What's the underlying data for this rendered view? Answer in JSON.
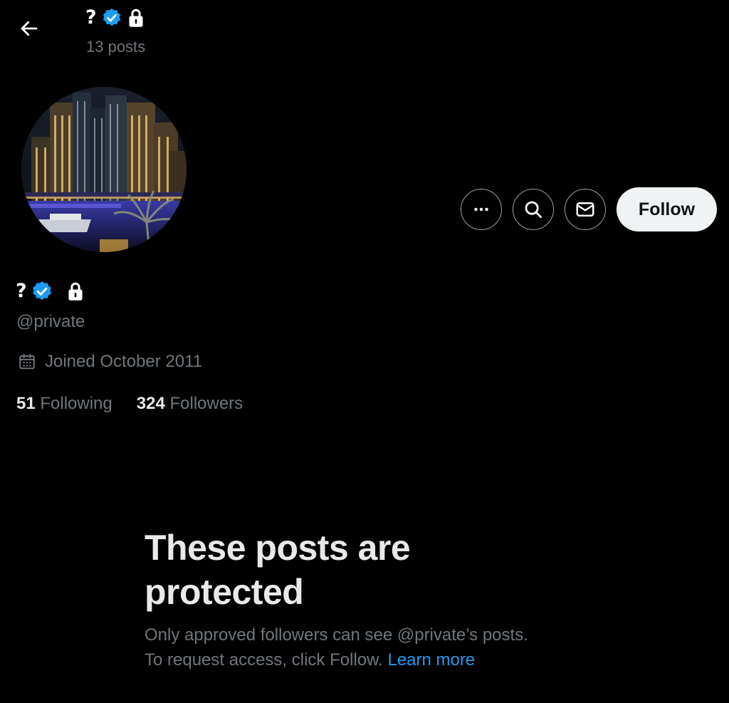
{
  "header": {
    "name": "?",
    "posts_count": "13 posts"
  },
  "actions": {
    "follow_label": "Follow"
  },
  "profile": {
    "name": "?",
    "handle": "@private",
    "joined": "Joined October 2011",
    "following_count": "51",
    "following_label": "Following",
    "followers_count": "324",
    "followers_label": "Followers"
  },
  "protected": {
    "title_line1": "These posts are",
    "title_line2": "protected",
    "line1": "Only approved followers can see @private’s posts.",
    "line2": "To request access, click Follow.",
    "learn_more": "Learn more"
  },
  "colors": {
    "background": "#000000",
    "text_primary": "#e7e9ea",
    "text_secondary": "#71767b",
    "verified_badge": "#1d9bf0",
    "link": "#1d9bf0"
  },
  "icons": {
    "back": "arrow-left-icon",
    "verified": "verified-badge-icon",
    "protected": "lock-icon",
    "more": "more-dots-icon",
    "search": "search-icon",
    "message": "envelope-icon",
    "calendar": "calendar-icon"
  }
}
